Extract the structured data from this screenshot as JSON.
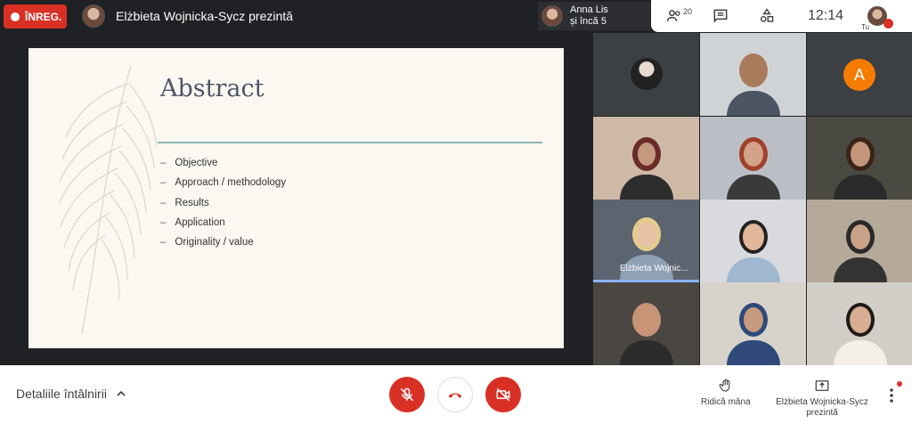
{
  "recording": {
    "label": "ÎNREG."
  },
  "presenter": {
    "text": "Elżbieta Wojnicka-Sycz prezintă"
  },
  "participant_preview": {
    "name": "Anna Lis",
    "more": "și încă 5"
  },
  "top_controls": {
    "participants_count": "20",
    "time": "12:14",
    "self_label": "Tu"
  },
  "slide": {
    "title": "Abstract",
    "bullets": [
      "Objective",
      "Approach / methodology",
      "Results",
      "Application",
      "Originality / value"
    ]
  },
  "tiles": [
    {
      "id": "t1",
      "label": ""
    },
    {
      "id": "t2",
      "label": ""
    },
    {
      "id": "t3",
      "letter": "A"
    },
    {
      "id": "t7",
      "label": "Elżbieta Wojnic..."
    }
  ],
  "bottom": {
    "details_label": "Detaliile întâlnirii",
    "raise_hand_label": "Ridică mâna",
    "present_label_line1": "Elżbieta Wojnicka-Sycz",
    "present_label_line2": "prezintă"
  },
  "colors": {
    "recording": "#d93025",
    "control_red": "#d93025",
    "accent_blue": "#8ab4f8",
    "avatar_orange": "#f57c00"
  }
}
